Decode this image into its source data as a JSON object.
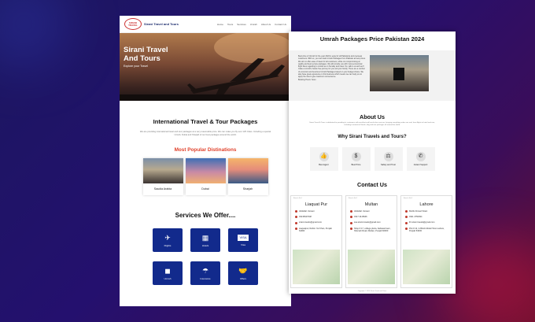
{
  "left": {
    "brand": "Sirani Travel and Tours",
    "logo_text": "SIRANI TRAVEL & TOURS",
    "menu": [
      "Home",
      "Tours",
      "Services",
      "Umrah",
      "About Us",
      "Contact Us"
    ],
    "hero": {
      "title_line1": "Sirani Travel",
      "title_line2": "And Tours",
      "subtitle": "Explore your Travel"
    },
    "intl_title": "International Travel & Tour Packages",
    "intl_text_1": "We are providing international travel and tour packages at a very reasonable price. We can make you fly",
    "intl_text_2": "over 125 Cities. Including a special Umrah, Dubai and Sharjah of our best packages around the world.",
    "popular_title": "Most Popular Distinations",
    "destinations": [
      "Saudia Arabia",
      "Dubai",
      "Sharjah"
    ],
    "services_title": "Services We Offer....",
    "services": [
      {
        "icon": "plane-icon",
        "label": "Flights"
      },
      {
        "icon": "hotel-icon",
        "label": "Hotels"
      },
      {
        "icon": "visa-icon",
        "label": "Visa"
      },
      {
        "icon": "umrah-icon",
        "label": "Umrah"
      },
      {
        "icon": "insurance-icon",
        "label": "Insurance"
      },
      {
        "icon": "handshake-icon",
        "label": "Offers"
      }
    ]
  },
  "right": {
    "umrah_title": "Umrah Packages Price Pakistan 2024",
    "umrah_text": "Best price of Umrah for the year 2024 is easy for all Pakistanis and overseas customers. With us, you can book Umrah Packages from Pakistan at best prices. We aim to offer ease of travel for all customers, while not compromising on quality and best service packages. We will provide you with most economical flight fares regarding to umrah as on Sunday and travel. So, talk to us and we'll make a smooth, hassle free journey for you and your family. There are a number of economic and luxurious Umrah Packages based on your budget choice. We also have great experience in this business which means we can help you to apply the visa to give maximum convenience.",
    "umrah_booking": "Booking Hours: Soon",
    "about_title": "About Us",
    "about_text": "Sirani Travel & Tours is dedicated to providing its customers with excellent and hassle-free services, bringing everything under one roof, from flights to hotel and visa, including economical Umrah, Hajj and tour packages all around the world.",
    "why_title": "Why Sirani Travels and Tours?",
    "why": [
      {
        "icon": "agent-icon",
        "label": "Best Agent"
      },
      {
        "icon": "price-icon",
        "label": "Best Price"
      },
      {
        "icon": "safety-icon",
        "label": "Safety and Trust"
      },
      {
        "icon": "support-icon",
        "label": "Instant Support"
      }
    ],
    "contact_title": "Contact Us",
    "offices": [
      {
        "tag": "Branch No 1",
        "city": "Liaquat Pur",
        "name": "Abdullah Usmani",
        "phone": "03135947048",
        "email": "sirani.travels@gmail.com",
        "address": "Liaquatpur, Rahim Yar Khan, Punjab 64000"
      },
      {
        "tag": "Branch No 2",
        "city": "Multan",
        "name": "Abdullah Usmani",
        "phone": "0317 4415946",
        "email": "ssa.sirani.travels@gmail.com",
        "address": "Shop # 17, college plaza, bahawal town, Shersah Road, Multan, Punjab 60000"
      },
      {
        "tag": "Branch No 3",
        "city": "Lahore",
        "name": "Muhib Ahmed Sirani",
        "phone": "0311 4756394",
        "email": "lhr.sirani.travels@gmail.com",
        "address": "Plot # 12, G Block Model Town Lahore, Punjab 54000"
      }
    ],
    "footer": "Copyright © 2024 Sirani Travel and Tours"
  }
}
